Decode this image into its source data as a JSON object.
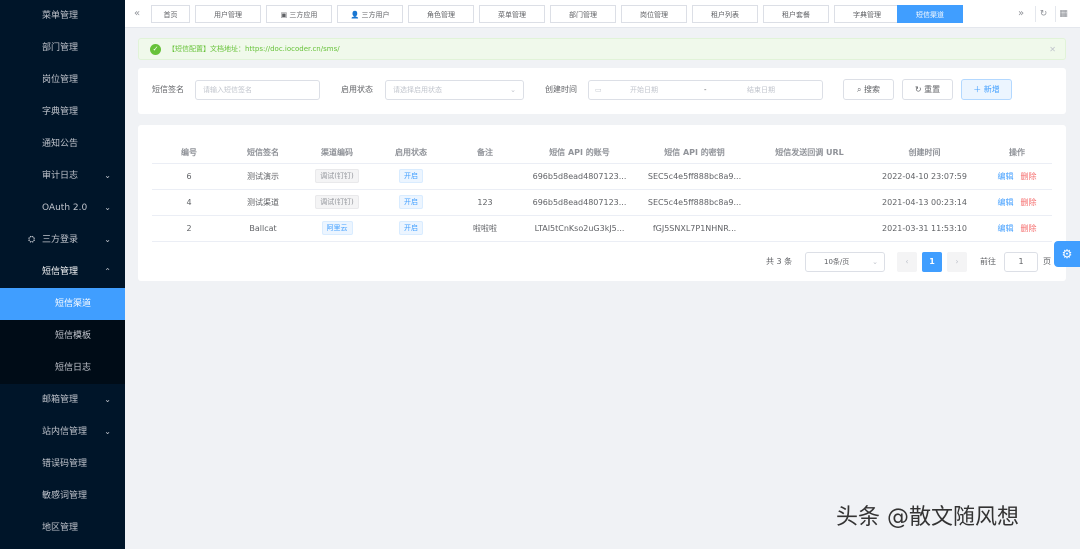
{
  "sidebar": {
    "items": [
      {
        "label": "菜单管理",
        "arrow": ""
      },
      {
        "label": "部门管理",
        "arrow": ""
      },
      {
        "label": "岗位管理",
        "arrow": ""
      },
      {
        "label": "字典管理",
        "arrow": ""
      },
      {
        "label": "通知公告",
        "arrow": ""
      },
      {
        "label": "审计日志",
        "arrow": "⌄"
      },
      {
        "label": "OAuth 2.0",
        "arrow": "⌄"
      },
      {
        "label": "三方登录",
        "arrow": "⌄"
      },
      {
        "label": "短信管理",
        "arrow": "⌃"
      },
      {
        "label": "短信渠道",
        "arrow": ""
      },
      {
        "label": "短信模板",
        "arrow": ""
      },
      {
        "label": "短信日志",
        "arrow": ""
      },
      {
        "label": "邮箱管理",
        "arrow": "⌄"
      },
      {
        "label": "站内信管理",
        "arrow": "⌄"
      },
      {
        "label": "错误码管理",
        "arrow": ""
      },
      {
        "label": "敏感词管理",
        "arrow": ""
      },
      {
        "label": "地区管理",
        "arrow": ""
      }
    ]
  },
  "tabs": [
    {
      "label": "首页"
    },
    {
      "label": "用户管理"
    },
    {
      "label": "三方应用"
    },
    {
      "label": "三方用户"
    },
    {
      "label": "角色管理"
    },
    {
      "label": "菜单管理"
    },
    {
      "label": "部门管理"
    },
    {
      "label": "岗位管理"
    },
    {
      "label": "租户列表"
    },
    {
      "label": "租户套餐"
    },
    {
      "label": "字典管理"
    },
    {
      "label": "短信渠道"
    }
  ],
  "alert": {
    "text": "【短信配置】文档地址：https://doc.iocoder.cn/sms/"
  },
  "search": {
    "sig_label": "短信签名",
    "sig_placeholder": "请输入短信签名",
    "status_label": "启用状态",
    "status_placeholder": "请选择启用状态",
    "time_label": "创建时间",
    "start_placeholder": "开始日期",
    "range_sep": "-",
    "end_placeholder": "结束日期",
    "search_btn": "搜索",
    "reset_btn": "重置",
    "add_btn": "新增"
  },
  "table": {
    "headers": [
      "编号",
      "短信签名",
      "渠道编码",
      "启用状态",
      "备注",
      "短信 API 的账号",
      "短信 API 的密钥",
      "短信发送回调 URL",
      "创建时间",
      "操作"
    ],
    "edit_label": "编辑",
    "delete_label": "删除",
    "rows": [
      {
        "id": "6",
        "signature": "测试演示",
        "code": "调试(钉钉)",
        "status": "开启",
        "remark": "",
        "api_key": "696b5d8ead4807123...",
        "api_secret": "SEC5c4e5ff888bc8a9...",
        "callback": "",
        "created": "2022-04-10 23:07:59"
      },
      {
        "id": "4",
        "signature": "测试渠道",
        "code": "调试(钉钉)",
        "status": "开启",
        "remark": "123",
        "api_key": "696b5d8ead4807123...",
        "api_secret": "SEC5c4e5ff888bc8a9...",
        "callback": "",
        "created": "2021-04-13 00:23:14"
      },
      {
        "id": "2",
        "signature": "Ballcat",
        "code": "阿里云",
        "status": "开启",
        "remark": "啦啦啦",
        "api_key": "LTAI5tCnKso2uG3kJ5...",
        "api_secret": "fGJ5SNXL7P1NHNR...",
        "callback": "",
        "created": "2021-03-31 11:53:10"
      }
    ]
  },
  "pagination": {
    "total": "共 3 条",
    "page_size": "10条/页",
    "current": "1",
    "goto_label": "前往",
    "goto_value": "1",
    "page_suffix": "页"
  },
  "watermark": "头条 @散文随风想"
}
